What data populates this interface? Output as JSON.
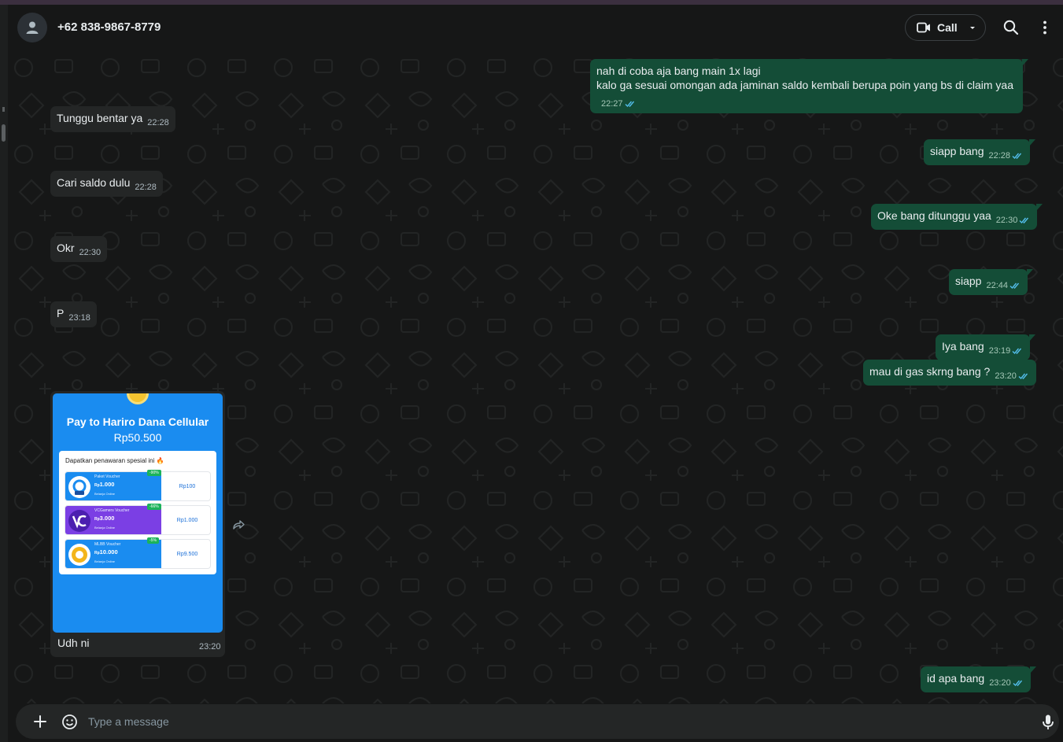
{
  "header": {
    "contact_name": "+62 838-9867-8779",
    "call_label": "Call"
  },
  "messages": [
    {
      "direction": "out",
      "lines": [
        "nah di coba aja bang main 1x lagi",
        "kalo ga sesuai omongan ada jaminan saldo kembali berupa poin yang bs di claim yaa"
      ],
      "time": "22:27",
      "status": "read"
    },
    {
      "direction": "in",
      "text": "Tunggu bentar ya",
      "time": "22:28"
    },
    {
      "direction": "out",
      "text": "siapp bang",
      "time": "22:28",
      "status": "read"
    },
    {
      "direction": "in",
      "text": "Cari saldo dulu",
      "time": "22:28"
    },
    {
      "direction": "out",
      "text": "Oke bang ditunggu yaa",
      "time": "22:30",
      "status": "read"
    },
    {
      "direction": "in",
      "text": "Okr",
      "time": "22:30"
    },
    {
      "direction": "out",
      "text": "siapp",
      "time": "22:44",
      "status": "read"
    },
    {
      "direction": "in",
      "text": "P",
      "time": "23:18"
    },
    {
      "direction": "out",
      "text": "Iya bang",
      "time": "23:19",
      "status": "read"
    },
    {
      "direction": "out",
      "text": "mau di gas skrng bang ?",
      "time": "23:20",
      "status": "read"
    },
    {
      "direction": "out",
      "text": "id apa bang",
      "time": "23:20",
      "status": "read"
    }
  ],
  "image_message": {
    "caption": "Udh ni",
    "time": "23:20",
    "image": {
      "title": "Pay to Hariro Dana Cellular",
      "amount": "Rp50.500",
      "offer_heading": "Dapatkan penawaran spesial ini 🔥",
      "vouchers": [
        {
          "name": "Paket Voucher",
          "price": "1.000",
          "currency": "Rp",
          "sub": "Belanja Online",
          "badge": "x2",
          "discount": "-90%",
          "right_price": "Rp100",
          "color": "#1a8cf0"
        },
        {
          "name": "VCGamers Voucher",
          "price": "3.000",
          "currency": "Rp",
          "sub": "Belanja Online",
          "badge": "",
          "discount": "-66%",
          "right_price": "Rp1.000",
          "color": "#7b3fe4"
        },
        {
          "name": "MLBB Voucher",
          "price": "10.000",
          "currency": "Rp",
          "sub": "Belanja Online",
          "badge": "",
          "discount": "-5%",
          "right_price": "Rp9.500",
          "color": "#1a8cf0"
        }
      ]
    }
  },
  "composer": {
    "placeholder": "Type a message"
  },
  "colors": {
    "outgoing_bubble": "#144d37",
    "incoming_bubble": "#242626",
    "read_tick": "#53bdeb"
  }
}
